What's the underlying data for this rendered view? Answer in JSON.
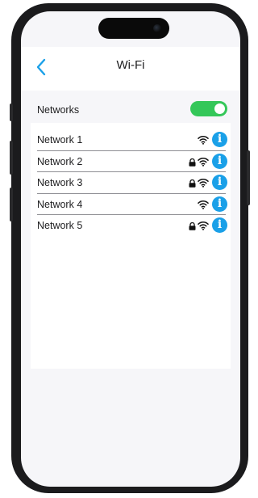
{
  "header": {
    "back_icon": "chevron-left-icon",
    "title": "Wi-Fi"
  },
  "wifi_toggle": {
    "label": "Networks",
    "on": true,
    "on_color": "#34c759"
  },
  "networks": [
    {
      "name": "Network 1",
      "locked": false
    },
    {
      "name": "Network 2",
      "locked": true
    },
    {
      "name": "Network 3",
      "locked": true
    },
    {
      "name": "Network 4",
      "locked": false
    },
    {
      "name": "Network 5",
      "locked": true
    }
  ],
  "icons": {
    "lock": "lock-icon",
    "wifi": "wifi-icon",
    "info": "info-icon",
    "info_glyph": "i"
  },
  "colors": {
    "accent": "#1aa0e8",
    "toggle_on": "#34c759",
    "background": "#f6f6f9"
  }
}
